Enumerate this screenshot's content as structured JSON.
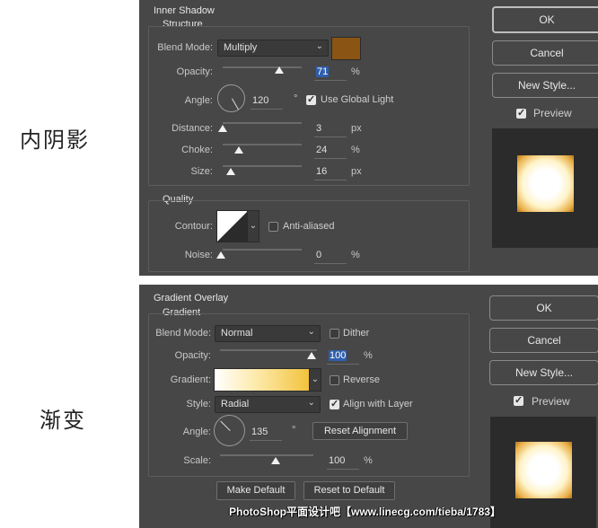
{
  "side_labels": {
    "inner_shadow": "内阴影",
    "gradient": "渐变"
  },
  "inner_shadow": {
    "title": "Inner Shadow",
    "structure_title": "Structure",
    "blend_mode_label": "Blend Mode:",
    "blend_mode": "Multiply",
    "swatch_color": "#8a5414",
    "opacity_label": "Opacity:",
    "opacity": "71",
    "opacity_fraction": 0.71,
    "angle_label": "Angle:",
    "angle": "120",
    "degree": "°",
    "use_global_light": "Use Global Light",
    "distance_label": "Distance:",
    "distance": "3",
    "choke_label": "Choke:",
    "choke": "24",
    "size_label": "Size:",
    "size": "16",
    "unit_px": "px",
    "unit_pct": "%",
    "quality_title": "Quality",
    "contour_label": "Contour:",
    "anti_aliased": "Anti-aliased",
    "noise_label": "Noise:",
    "noise": "0"
  },
  "gradient_overlay": {
    "title": "Gradient Overlay",
    "gradient_title": "Gradient",
    "blend_mode_label": "Blend Mode:",
    "blend_mode": "Normal",
    "dither": "Dither",
    "opacity_label": "Opacity:",
    "opacity": "100",
    "opacity_fraction": 1.0,
    "gradient_label": "Gradient:",
    "reverse": "Reverse",
    "style_label": "Style:",
    "style": "Radial",
    "align_with_layer": "Align with Layer",
    "angle_label": "Angle:",
    "angle": "135",
    "degree": "°",
    "reset_alignment": "Reset Alignment",
    "scale_label": "Scale:",
    "scale": "100",
    "unit_pct": "%",
    "make_default": "Make Default",
    "reset_to_default": "Reset to Default"
  },
  "buttons": {
    "ok": "OK",
    "cancel": "Cancel",
    "new_style": "New Style...",
    "preview": "Preview"
  },
  "watermark": "PhotoShop平面设计吧【www.linecg.com/tieba/1783】",
  "colors": {
    "panel_bg": "#474747",
    "highlight": "#2f5fae",
    "gold": "#e0a030"
  }
}
